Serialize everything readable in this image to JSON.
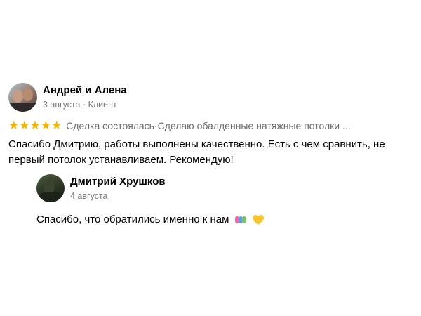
{
  "review": {
    "author": "Андрей и Алена",
    "date": "3 августа",
    "separator": " · ",
    "role": "Клиент",
    "rating": 5,
    "deal_status": "Сделка состоялась",
    "deal_sep": " · ",
    "deal_title": "Сделаю обалденные натяжные потолки ...",
    "text": "Спасибо Дмитрию, работы выполнены качественно. Есть с чем сравнить, не первый потолок устанавливаем. Рекомендую!"
  },
  "reply": {
    "author": "Дмитрий Хрушков",
    "date": "4 августа",
    "text": "Спасибо, что обратились именно к нам",
    "emojis": [
      "people-holding-hands-emoji",
      "yellow-heart-emoji"
    ]
  },
  "colors": {
    "star": "#f5b400",
    "meta_text": "#7a7a7a"
  }
}
